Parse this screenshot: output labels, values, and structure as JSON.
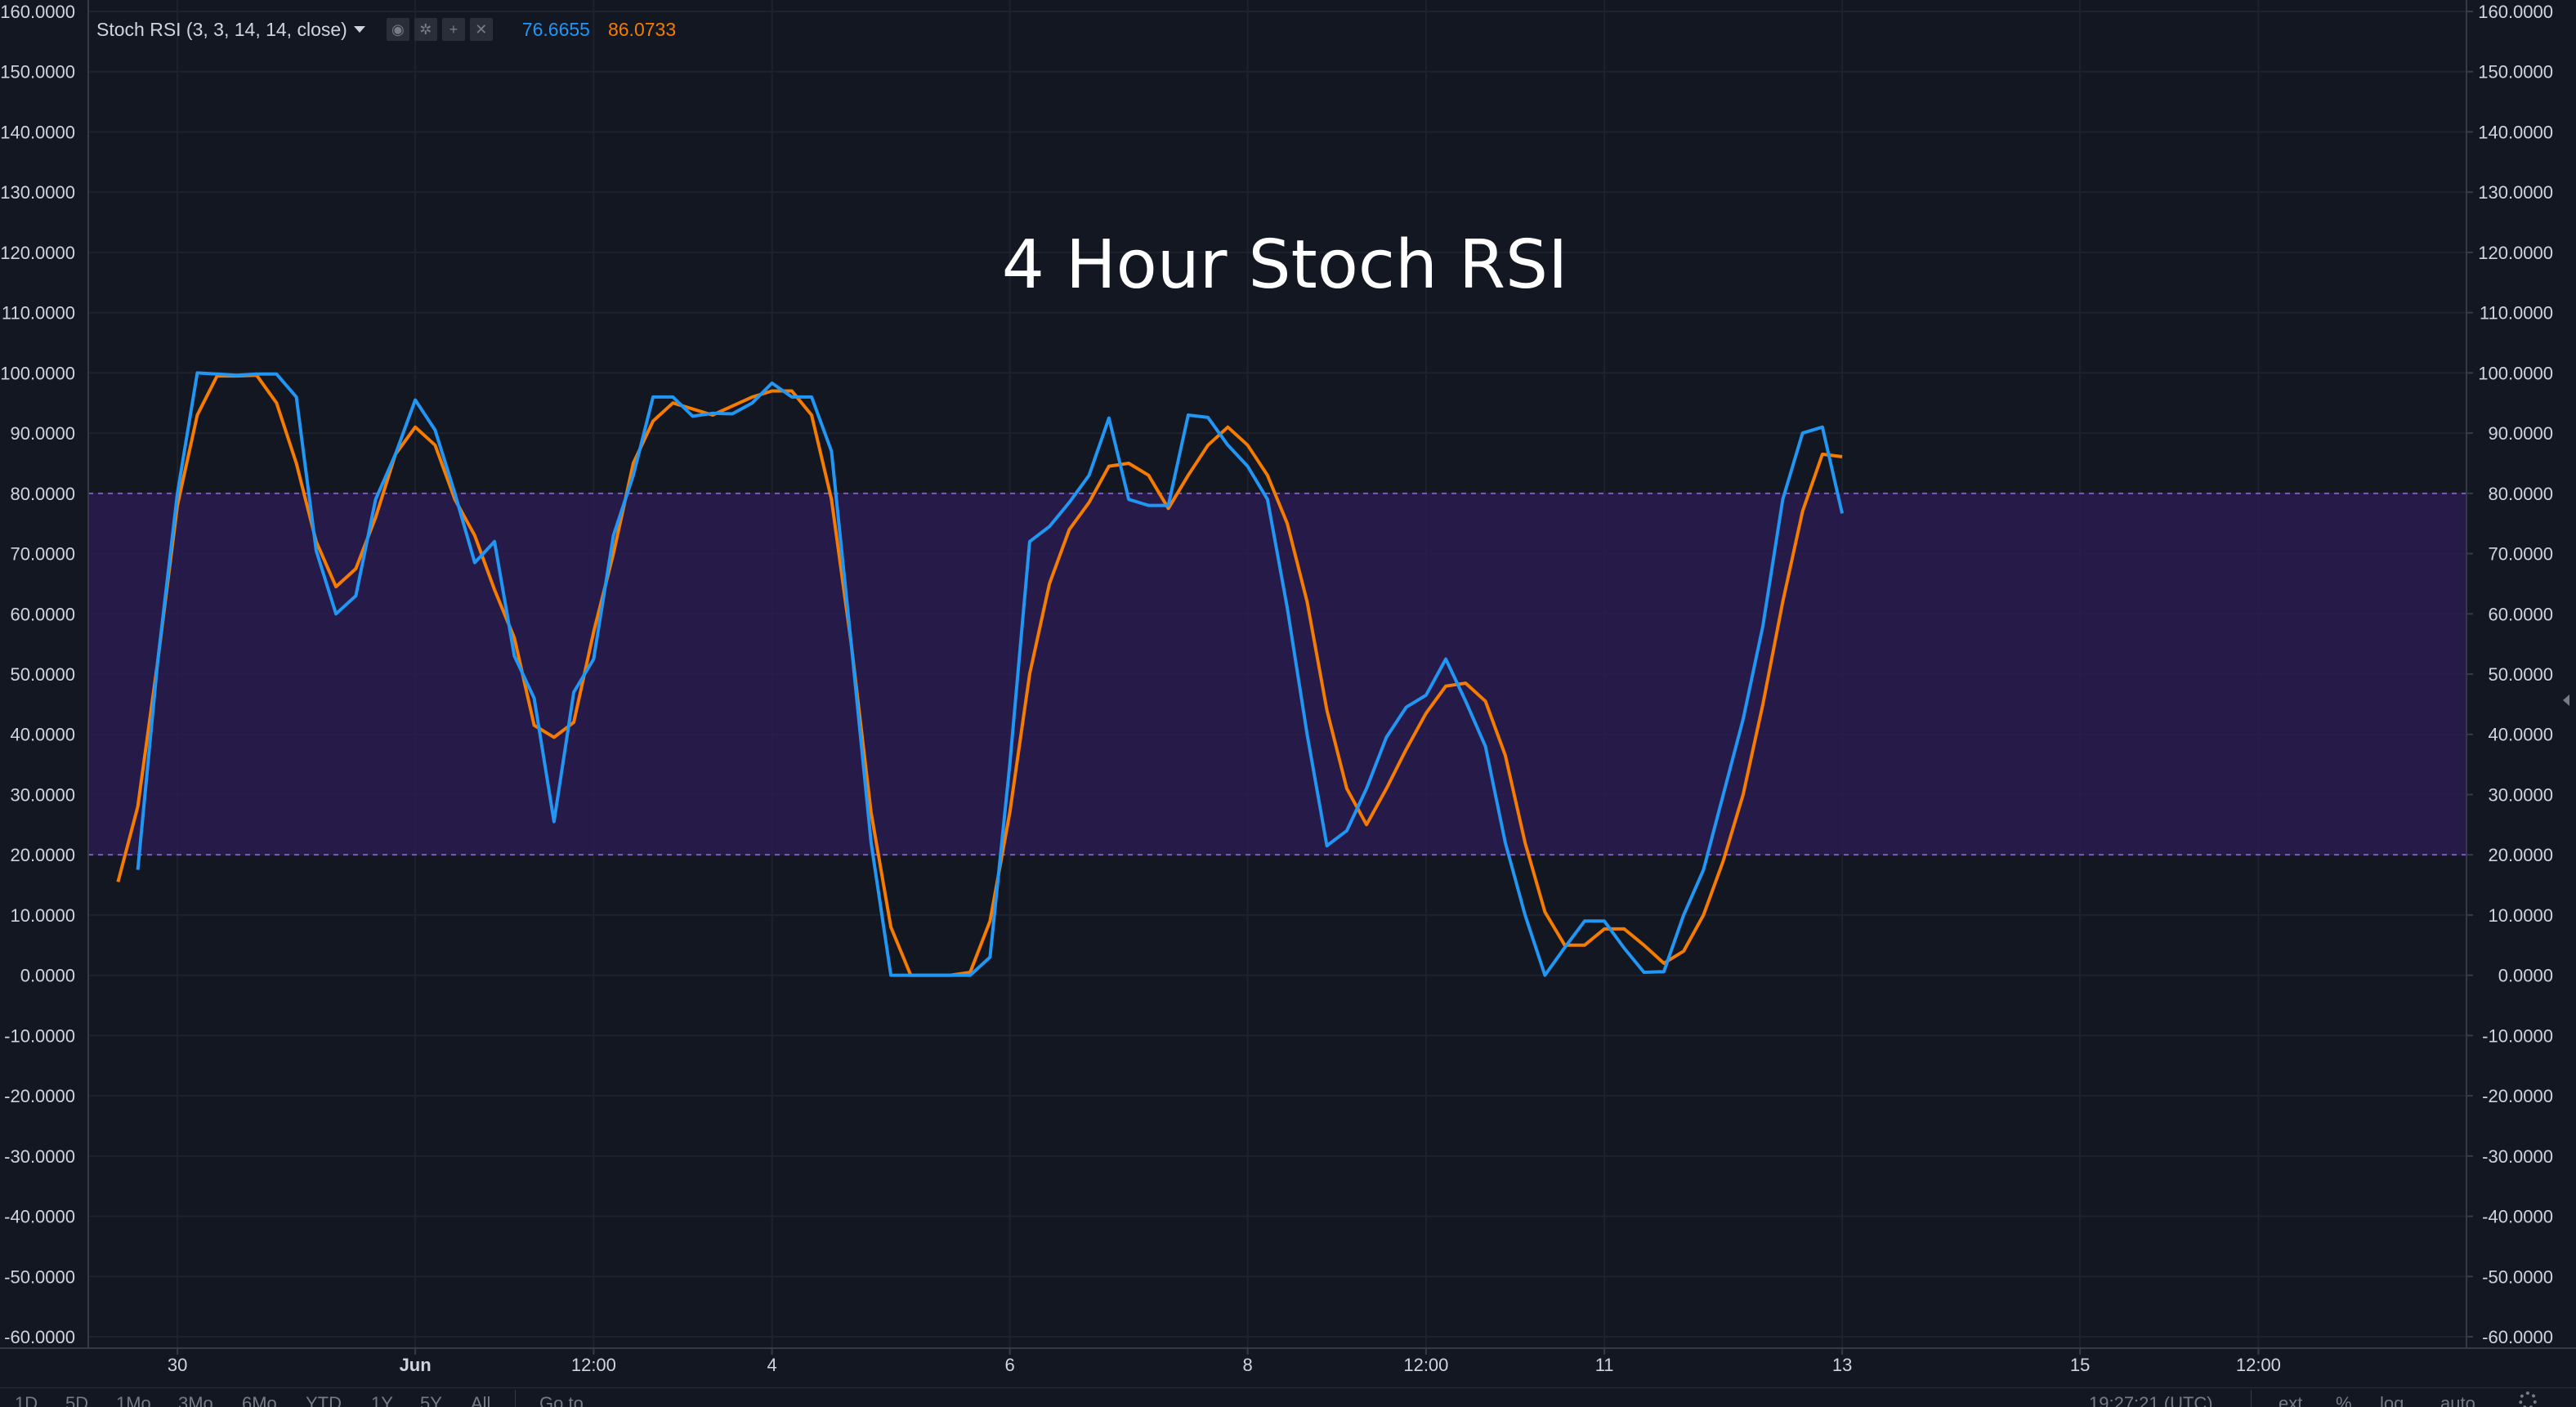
{
  "indicator": {
    "title": "Stoch RSI (3, 3, 14, 14, close)",
    "value_k": "76.6655",
    "value_d": "86.0733",
    "controls": [
      "eye-icon",
      "gear-icon",
      "plus-icon",
      "close-icon"
    ]
  },
  "colors": {
    "background": "#131722",
    "grid": "#1e222d",
    "k_line": "#2196f3",
    "d_line": "#f57c00",
    "band_fill": "#2a1b4f",
    "band_border": "#7e57c2",
    "axis_text": "#d1d4dc",
    "axis_line": "#363a45"
  },
  "bottom_bar": {
    "ranges": [
      "1D",
      "5D",
      "1Mo",
      "3Mo",
      "6Mo",
      "YTD",
      "1Y",
      "5Y",
      "All"
    ],
    "goto": "Go to...",
    "clock": "19:27:21 (UTC)",
    "toggles": [
      "ext",
      "%",
      "log",
      "auto"
    ]
  },
  "chart_data": {
    "type": "line",
    "title": "4 Hour Stoch RSI",
    "ylim": [
      -60,
      160
    ],
    "y_ticks": [
      "160.0000",
      "150.0000",
      "140.0000",
      "130.0000",
      "120.0000",
      "110.0000",
      "100.0000",
      "90.0000",
      "80.0000",
      "70.0000",
      "60.0000",
      "50.0000",
      "40.0000",
      "30.0000",
      "20.0000",
      "10.0000",
      "0.0000",
      "-10.0000",
      "-20.0000",
      "-30.0000",
      "-40.0000",
      "-50.0000",
      "-60.0000"
    ],
    "x_ticks": [
      {
        "label": "30",
        "bar": 4.5,
        "bold": false
      },
      {
        "label": "Jun",
        "bar": 16.5,
        "bold": true
      },
      {
        "label": "12:00",
        "bar": 25.5,
        "bold": false
      },
      {
        "label": "4",
        "bar": 34.5,
        "bold": false
      },
      {
        "label": "6",
        "bar": 46.5,
        "bold": false
      },
      {
        "label": "8",
        "bar": 58.5,
        "bold": false
      },
      {
        "label": "12:00",
        "bar": 67.5,
        "bold": false
      },
      {
        "label": "11",
        "bar": 76.5,
        "bold": false
      },
      {
        "label": "13",
        "bar": 88.5,
        "bold": false
      },
      {
        "label": "15",
        "bar": 100.5,
        "bold": false
      },
      {
        "label": "12:00",
        "bar": 109.5,
        "bold": false
      }
    ],
    "bar_count": 120,
    "bands": {
      "upper": 80,
      "lower": 20
    },
    "series": [
      {
        "name": "K",
        "values": [
          17.5,
          52,
          80,
          100,
          99.8,
          99.6,
          99.8,
          99.8,
          96,
          70.5,
          60,
          63,
          79,
          86.5,
          95.5,
          90.5,
          80,
          68.5,
          72,
          53,
          46,
          25.5,
          47,
          52.5,
          73,
          83,
          96,
          96,
          92.8,
          93.3,
          93.2,
          95,
          98.3,
          96,
          96,
          87,
          55,
          22,
          0,
          0,
          0,
          0,
          0,
          3,
          35,
          72,
          74.5,
          78.5,
          83,
          92.5,
          79,
          78,
          78,
          93,
          92.6,
          88,
          84.5,
          79,
          61,
          40,
          21.5,
          24,
          31,
          39.5,
          44.5,
          46.5,
          52.5,
          45.5,
          38,
          22,
          10,
          0,
          4.6,
          9,
          9,
          4.5,
          0.5,
          0.6,
          10,
          17.5,
          30,
          42.5,
          58,
          79,
          90,
          91,
          76.6655
        ],
        "end_bar": 88.5
      },
      {
        "name": "D",
        "values": [
          15.5,
          28,
          52,
          78,
          93,
          99.5,
          99.5,
          99.6,
          95,
          85,
          72,
          64.5,
          67.5,
          76,
          86.5,
          91,
          88,
          79,
          73,
          64,
          56,
          41.5,
          39.5,
          42,
          57,
          70,
          85,
          92,
          95,
          94,
          93,
          94.5,
          96,
          97,
          97,
          93,
          79,
          55,
          27,
          8,
          0,
          0,
          0,
          0.5,
          9,
          27,
          50,
          65,
          74,
          78.5,
          84.5,
          85,
          83,
          77.5,
          83,
          88,
          91,
          88,
          83,
          75,
          62,
          44,
          31,
          25,
          31,
          37.5,
          43.5,
          48,
          48.5,
          45.5,
          36.5,
          22,
          10.5,
          5,
          5,
          7.7,
          7.7,
          5,
          2,
          4,
          10,
          19,
          30,
          45,
          62,
          77,
          86.5,
          86.0733
        ],
        "end_bar": 88.5
      }
    ]
  }
}
